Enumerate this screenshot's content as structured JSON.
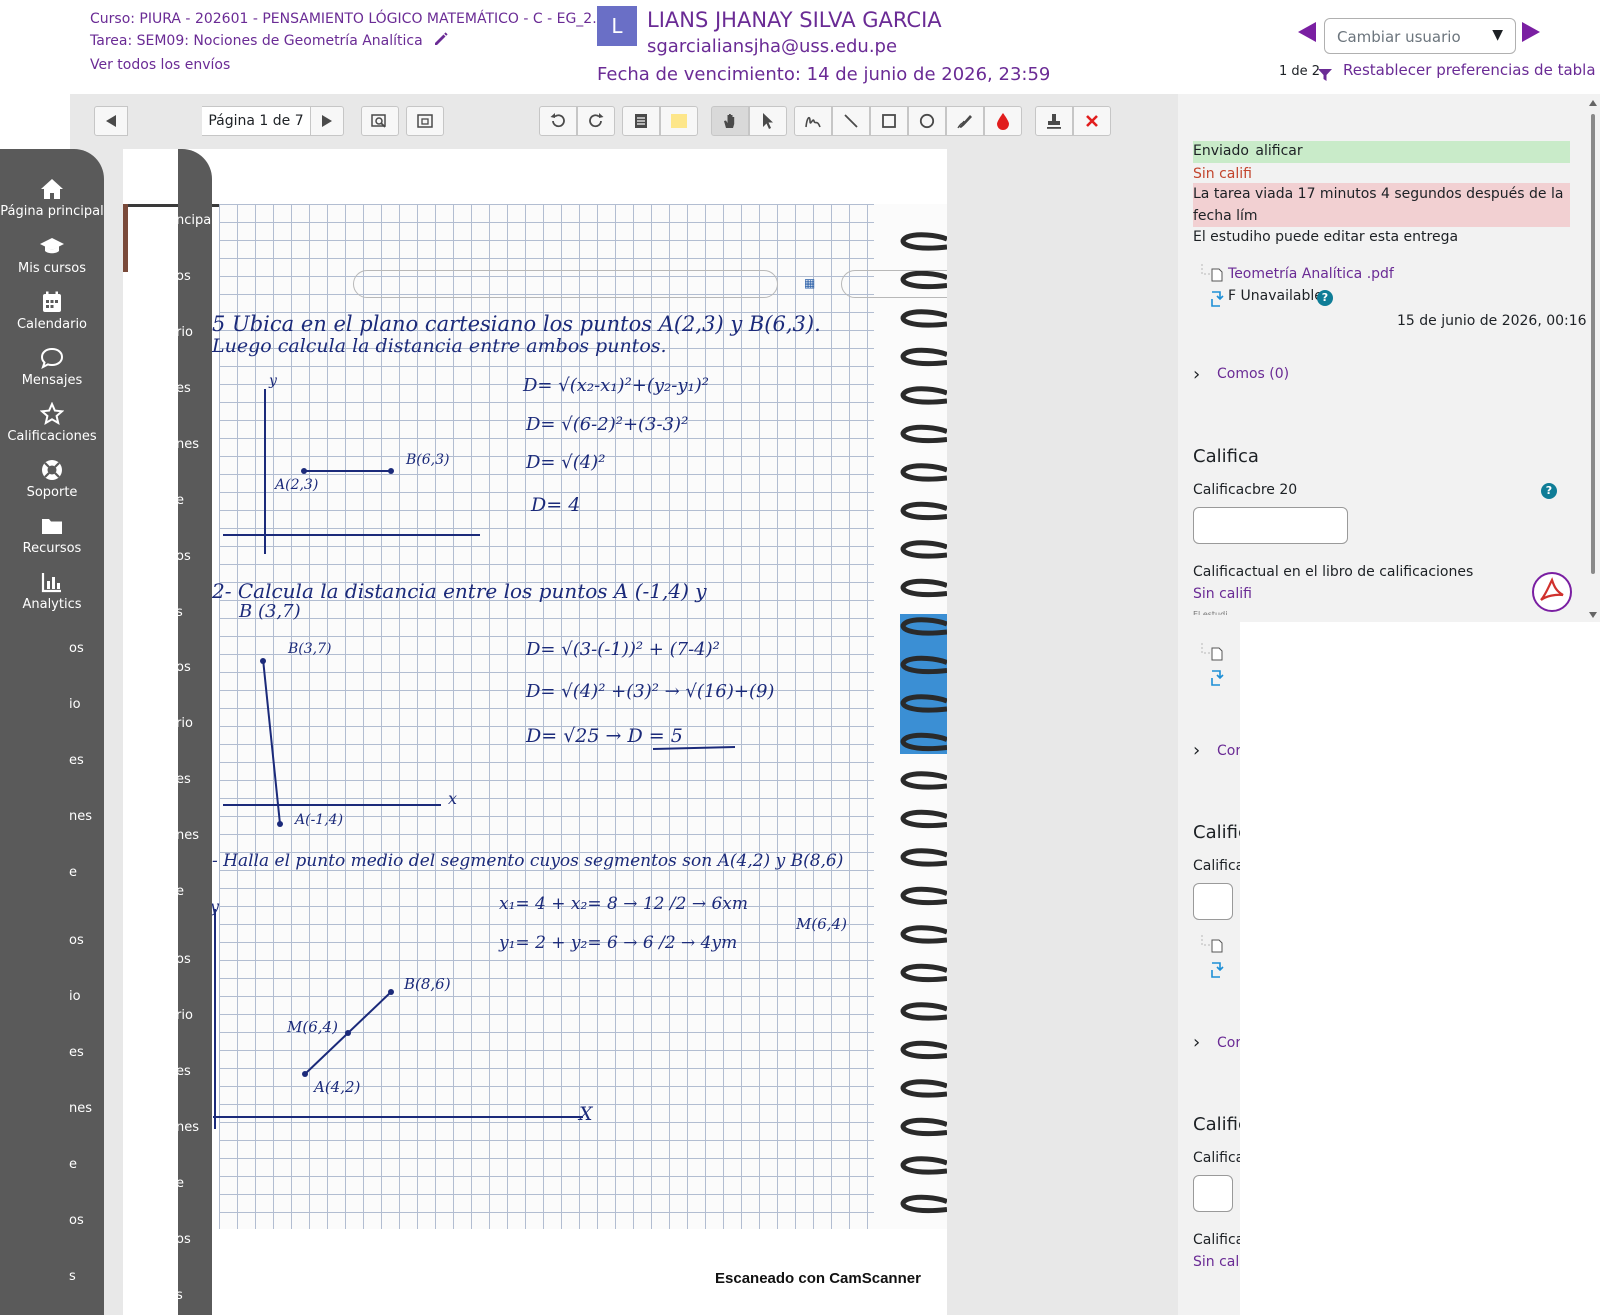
{
  "header": {
    "course": "Curso: PIURA - 202601 - PENSAMIENTO LÓGICO MATEMÁTICO - C - EG_2...",
    "task": "Tarea: SEM09: Nociones de Geometría Analítica",
    "view_all": "Ver todos los envíos",
    "avatar_letter": "L",
    "user_name": "LIANS JHANAY SILVA GARCIA",
    "user_email": "sgarcialiansjha@uss.edu.pe",
    "due_date": "Fecha de vencimiento: 14 de junio de 2026, 23:59",
    "change_user_placeholder": "Cambiar usuario",
    "count": "1 de 2",
    "reset_prefs": "Restablecer preferencias de tabla"
  },
  "toolbar": {
    "page_label": "Página 1 de 7",
    "tools": [
      "prev-page",
      "next-page",
      "search",
      "expand",
      "rotate-left",
      "rotate-right",
      "comment",
      "sticky-note",
      "pan",
      "select",
      "pen",
      "line",
      "rectangle",
      "oval",
      "highlighter",
      "color",
      "stamp",
      "delete"
    ],
    "accent_colors": {
      "sticky": "#fde68a",
      "drop": "#e11d1d",
      "delete": "#e11d1d"
    }
  },
  "nav_drawer": {
    "items": [
      {
        "label": "Página principal",
        "icon": "home-icon"
      },
      {
        "label": "Mis cursos",
        "icon": "graduation-cap-icon"
      },
      {
        "label": "Calendario",
        "icon": "calendar-icon"
      },
      {
        "label": "Mensajes",
        "icon": "chat-icon"
      },
      {
        "label": "Calificaciones",
        "icon": "star-icon"
      },
      {
        "label": "Soporte",
        "icon": "lifebuoy-icon"
      },
      {
        "label": "Recursos",
        "icon": "folder-icon"
      },
      {
        "label": "Analytics",
        "icon": "bar-chart-icon"
      }
    ],
    "ghost_labels": [
      "os",
      "io",
      "es",
      "nes",
      "e",
      "os",
      "io",
      "es",
      "nes",
      "e",
      "os",
      "s"
    ],
    "ghost2_labels": [
      "ncipal",
      "os",
      "rio",
      "es",
      "nes",
      "e",
      "os",
      "s",
      "os",
      "rio",
      "es",
      "nes",
      "e",
      "os",
      "rio",
      "es",
      "nes",
      "e",
      "os",
      "s"
    ]
  },
  "document": {
    "footer_stamp": "Escaneado con CamScanner",
    "lines": [
      "5 Ubica en el plano cartesiano los puntos A(2,3) y B(6,3).",
      "Luego calcula la distancia entre ambos puntos.",
      "D= √(x₂-x₁)²+(y₂-y₁)²",
      "D= √(6-2)²+(3-3)²",
      "D= √(4)²",
      "D= 4",
      "B(6,3)",
      "A(2,3)",
      "2- Calcula la distancia entre los puntos A (-1,4) y",
      "B (3,7)",
      "B(3,7)",
      "D= √(3-(-1))² + (7-4)²",
      "D= √(4)² +(3)² → √(16)+(9)",
      "D= √25 → D = 5",
      "A(-1,4)",
      "x",
      "- Halla el punto medio del segmento cuyos segmentos son A(4,2) y B(8,6)",
      "x₁= 4 + x₂= 8 → 12 /2 → 6xm",
      "y₁= 2 + y₂= 6 → 6 /2 → 4ym",
      "M(6,4)",
      "B(8,6)",
      "M(6,4)",
      "A(4,2)",
      "X",
      "y",
      "y"
    ]
  },
  "panel": {
    "status_submitted": "Enviado",
    "status_grading": "alificar",
    "status_no_grade": "Sin califi",
    "late_line1": "La tarea",
    "late_line1b": "viada 17 minutos 4 segundos después de la",
    "late_line2": "fecha lím",
    "editable": "El estudi",
    "editable_b": "ho puede editar esta entrega",
    "file_prefix": "T",
    "file_name": "eometría Analítica .pdf",
    "file_status_prefix": "F",
    "file_status": "Unavailable",
    "file_date": "15 de junio de 2026, 00:16",
    "comments": "Comos (0)",
    "grade_heading": "Califica",
    "grade_label": "Calificac",
    "grade_label_b": "bre 20",
    "current_grade_label": "Calificac",
    "current_grade_label_b": "tual en el libro de calificaciones",
    "current_grade_value": "Sin califi",
    "trunc_dots": "El estudi",
    "ghost_comments": "Cor",
    "ghost_heading": "Calific",
    "ghost_label": "Califica",
    "ghost_comments2": "Cor",
    "ghost_heading2": "Calific",
    "ghost_label2": "Califica",
    "ghost_label3": "Califica",
    "ghost_value3": "Sin cali"
  }
}
